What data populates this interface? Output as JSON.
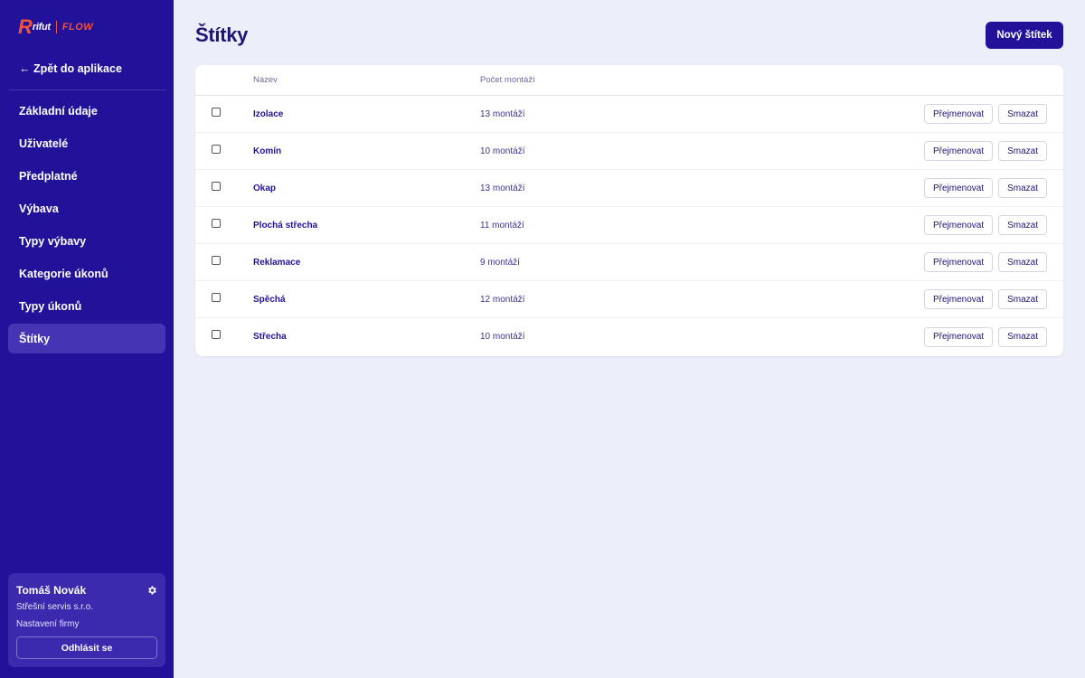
{
  "brand": {
    "logo_letter": "R",
    "logo_word": "rifut",
    "logo_product": "FLOW",
    "accent_color": "#f0533e",
    "sidebar_color": "#22129a"
  },
  "sidebar": {
    "back_link": "← Zpět do aplikace",
    "items": [
      {
        "label": "Základní údaje",
        "active": false
      },
      {
        "label": "Uživatelé",
        "active": false
      },
      {
        "label": "Předplatné",
        "active": false
      },
      {
        "label": "Výbava",
        "active": false
      },
      {
        "label": "Typy výbavy",
        "active": false
      },
      {
        "label": "Kategorie úkonů",
        "active": false
      },
      {
        "label": "Typy úkonů",
        "active": false
      },
      {
        "label": "Štítky",
        "active": true
      }
    ],
    "user": {
      "name": "Tomáš Novák",
      "company": "Střešní servis s.r.o.",
      "settings_link": "Nastavení firmy",
      "logout_label": "Odhlásit se"
    }
  },
  "main": {
    "title": "Štítky",
    "new_button": "Nový štítek",
    "table": {
      "columns": {
        "name": "Název",
        "count": "Počet montáží"
      },
      "rename_label": "Přejmenovat",
      "delete_label": "Smazat",
      "rows": [
        {
          "name": "Izolace",
          "count": "13 montáží"
        },
        {
          "name": "Komín",
          "count": "10 montáží"
        },
        {
          "name": "Okap",
          "count": "13 montáží"
        },
        {
          "name": "Plochá střecha",
          "count": "11 montáží"
        },
        {
          "name": "Reklamace",
          "count": "9 montáží"
        },
        {
          "name": "Spěchá",
          "count": "12 montáží"
        },
        {
          "name": "Střecha",
          "count": "10 montáží"
        }
      ]
    }
  }
}
